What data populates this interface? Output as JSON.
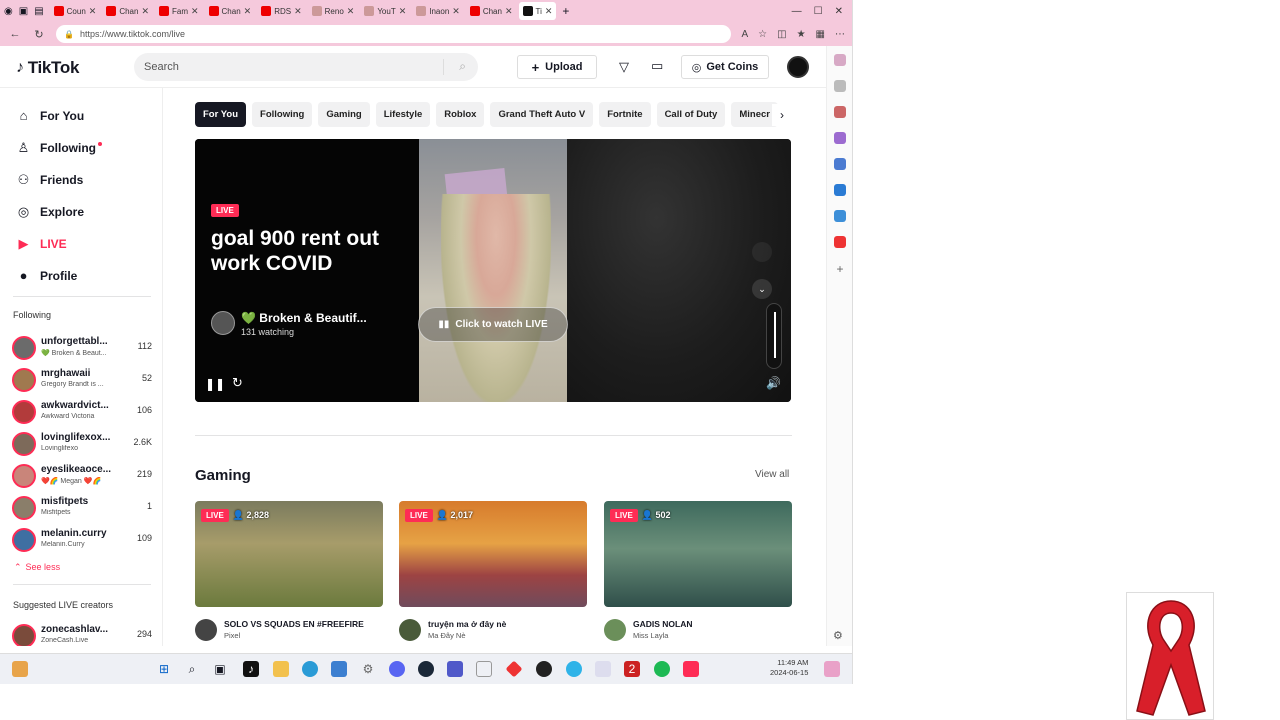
{
  "browser": {
    "tabs": [
      {
        "label": "Coun",
        "icon": "youtube-icon"
      },
      {
        "label": "Chan",
        "icon": "youtube-icon"
      },
      {
        "label": "Fam",
        "icon": "youtube-icon"
      },
      {
        "label": "Chan",
        "icon": "youtube-icon"
      },
      {
        "label": "RDS",
        "icon": "youtube-icon"
      },
      {
        "label": "Reno",
        "icon": "generic-icon"
      },
      {
        "label": "YouT",
        "icon": "generic-icon"
      },
      {
        "label": "Inaon",
        "icon": "generic-icon"
      },
      {
        "label": "Chan",
        "icon": "youtube-icon"
      },
      {
        "label": "Ti",
        "icon": "tiktok-icon"
      }
    ],
    "url": "https://www.tiktok.com/live"
  },
  "header": {
    "logo": "TikTok",
    "search_placeholder": "Search",
    "upload_label": "Upload",
    "coins_label": "Get Coins"
  },
  "sidebar": {
    "nav": [
      {
        "label": "For You",
        "icon": "home-icon"
      },
      {
        "label": "Following",
        "icon": "following-icon"
      },
      {
        "label": "Friends",
        "icon": "friends-icon"
      },
      {
        "label": "Explore",
        "icon": "compass-icon"
      },
      {
        "label": "LIVE",
        "icon": "live-icon"
      },
      {
        "label": "Profile",
        "icon": "profile-icon"
      }
    ],
    "following_heading": "Following",
    "following": [
      {
        "name": "unforgettabl...",
        "sub": "💚 Broken & Beaut...",
        "count": "112"
      },
      {
        "name": "mrghawaii",
        "sub": "Gregory Brandt is ...",
        "count": "52"
      },
      {
        "name": "awkwardvict...",
        "sub": "Awkward Victoria",
        "count": "106"
      },
      {
        "name": "lovinglifexox...",
        "sub": "Lovinglifexo",
        "count": "2.6K"
      },
      {
        "name": "eyeslikeaoce...",
        "sub": "❤️🌈 Megan ❤️🌈",
        "count": "219"
      },
      {
        "name": "misfitpets",
        "sub": "Misfitpets",
        "count": "1"
      },
      {
        "name": "melanin.curry",
        "sub": "Melanin.Curry",
        "count": "109"
      }
    ],
    "see_less": "See less",
    "suggested_heading": "Suggested LIVE creators",
    "suggested": [
      {
        "name": "zonecashlav...",
        "sub": "ZoneCash.Live",
        "count": "294"
      }
    ]
  },
  "chips": [
    "For You",
    "Following",
    "Gaming",
    "Lifestyle",
    "Roblox",
    "Grand Theft Auto V",
    "Fortnite",
    "Call of Duty",
    "Minecr"
  ],
  "player": {
    "live_badge": "LIVE",
    "title": "goal 900 rent out work COVID",
    "host_name": "Broken & Beautif...",
    "host_heart": "💚",
    "watching": "131 watching",
    "watch_button": "Click to watch LIVE"
  },
  "gaming": {
    "title": "Gaming",
    "view_all": "View all",
    "cards": [
      {
        "badge": "LIVE",
        "viewers": "2,828",
        "title": "SOLO VS SQUADS EN #FREEFIRE",
        "user": "Pixel"
      },
      {
        "badge": "LIVE",
        "viewers": "2,017",
        "title": "truyện ma ở đây nè",
        "user": "Ma Đây Nè"
      },
      {
        "badge": "LIVE",
        "viewers": "502",
        "title": "GADIS NOLAN",
        "user": "Miss Layla"
      }
    ]
  },
  "taskbar": {
    "time": "11:49 AM",
    "date": "2024-06-15"
  },
  "colors": {
    "accent": "#fe2c55",
    "tab_bar": "#f5c9dc",
    "live_green": "#25d366"
  }
}
